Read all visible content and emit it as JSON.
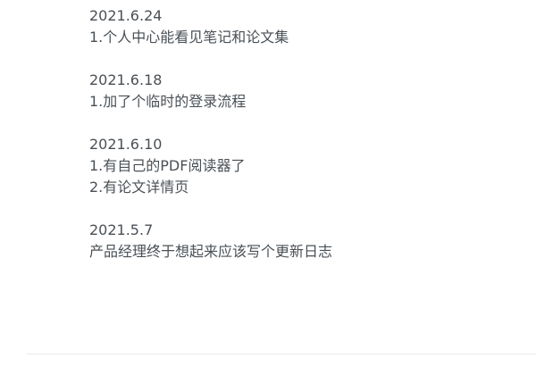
{
  "changelog": {
    "entries": [
      {
        "date": "2021.6.24",
        "lines": [
          "1.个人中心能看见笔记和论文集"
        ]
      },
      {
        "date": "2021.6.18",
        "lines": [
          "1.加了个临时的登录流程"
        ]
      },
      {
        "date": "2021.6.10",
        "lines": [
          "1.有自己的PDF阅读器了",
          "2.有论文详情页"
        ]
      },
      {
        "date": "2021.5.7",
        "lines": [
          "产品经理终于想起来应该写个更新日志"
        ]
      }
    ]
  }
}
